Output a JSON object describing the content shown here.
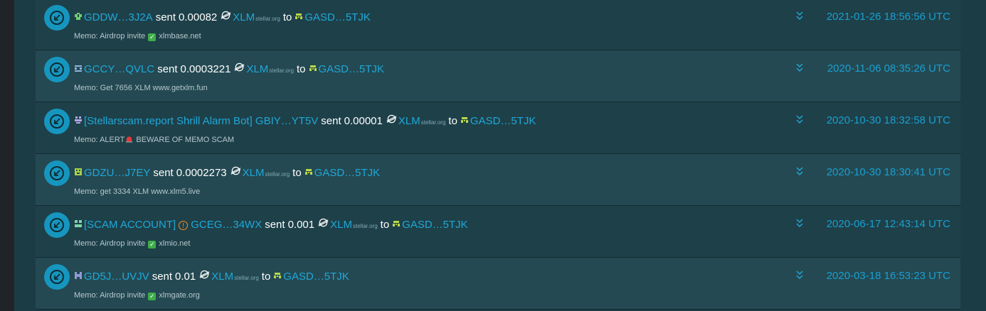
{
  "colors": {
    "accent": "#1fa8d8",
    "row_alt": "#244952",
    "row": "#1e4049",
    "check": "#3fae49",
    "warn": "#ff8a1a"
  },
  "rows": [
    {
      "from": "GDDW…3J2A",
      "verb": "sent",
      "amount": "0.00082",
      "asset": "XLM",
      "asset_domain": "stellar.org",
      "to_word": "to",
      "to": "GASD…5TJK",
      "memo_prefix": "Memo: Airdrop invite",
      "memo_suffix": "xlmbase.net",
      "date": "2021-01-26 18:56:56 UTC",
      "from_icon": "identicon-green"
    },
    {
      "from": "GCCY…QVLC",
      "verb": "sent",
      "amount": "0.0003221",
      "asset": "XLM",
      "asset_domain": "stellar.org",
      "to_word": "to",
      "to": "GASD…5TJK",
      "memo_prefix": "Memo: Get 7656 XLM www.getxlm.fun",
      "memo_suffix": "",
      "date": "2020-11-06 08:35:26 UTC",
      "from_icon": "identicon-blue"
    },
    {
      "from": "[Stellarscam.report Shrill Alarm Bot] GBIY…YT5V",
      "verb": "sent",
      "amount": "0.00001",
      "asset": "XLM",
      "asset_domain": "stellar.org",
      "to_word": "to",
      "to": "GASD…5TJK",
      "memo_prefix": "Memo: ALERT",
      "memo_suffix": "BEWARE OF MEMO SCAM",
      "date": "2020-10-30 18:32:58 UTC",
      "from_icon": "identicon-purple"
    },
    {
      "from": "GDZU…J7EY",
      "verb": "sent",
      "amount": "0.0002273",
      "asset": "XLM",
      "asset_domain": "stellar.org",
      "to_word": "to",
      "to": "GASD…5TJK",
      "memo_prefix": "Memo: get 3334 XLM www.xlm5.live",
      "memo_suffix": "",
      "date": "2020-10-30 18:30:41 UTC",
      "from_icon": "identicon-lime"
    },
    {
      "from_label": "[SCAM ACCOUNT]",
      "from": "GCEG…34WX",
      "verb": "sent",
      "amount": "0.001",
      "asset": "XLM",
      "asset_domain": "stellar.org",
      "to_word": "to",
      "to": "GASD…5TJK",
      "memo_prefix": "Memo: Airdrop invite",
      "memo_suffix": "xlmio.net",
      "date": "2020-06-17 12:43:14 UTC",
      "from_icon": "identicon-teal"
    },
    {
      "from": "GD5J…UVJV",
      "verb": "sent",
      "amount": "0.01",
      "asset": "XLM",
      "asset_domain": "stellar.org",
      "to_word": "to",
      "to": "GASD…5TJK",
      "memo_prefix": "Memo: Airdrop invite",
      "memo_suffix": "xlmgate.org",
      "date": "2020-03-18 16:53:23 UTC",
      "from_icon": "identicon-indigo"
    }
  ]
}
